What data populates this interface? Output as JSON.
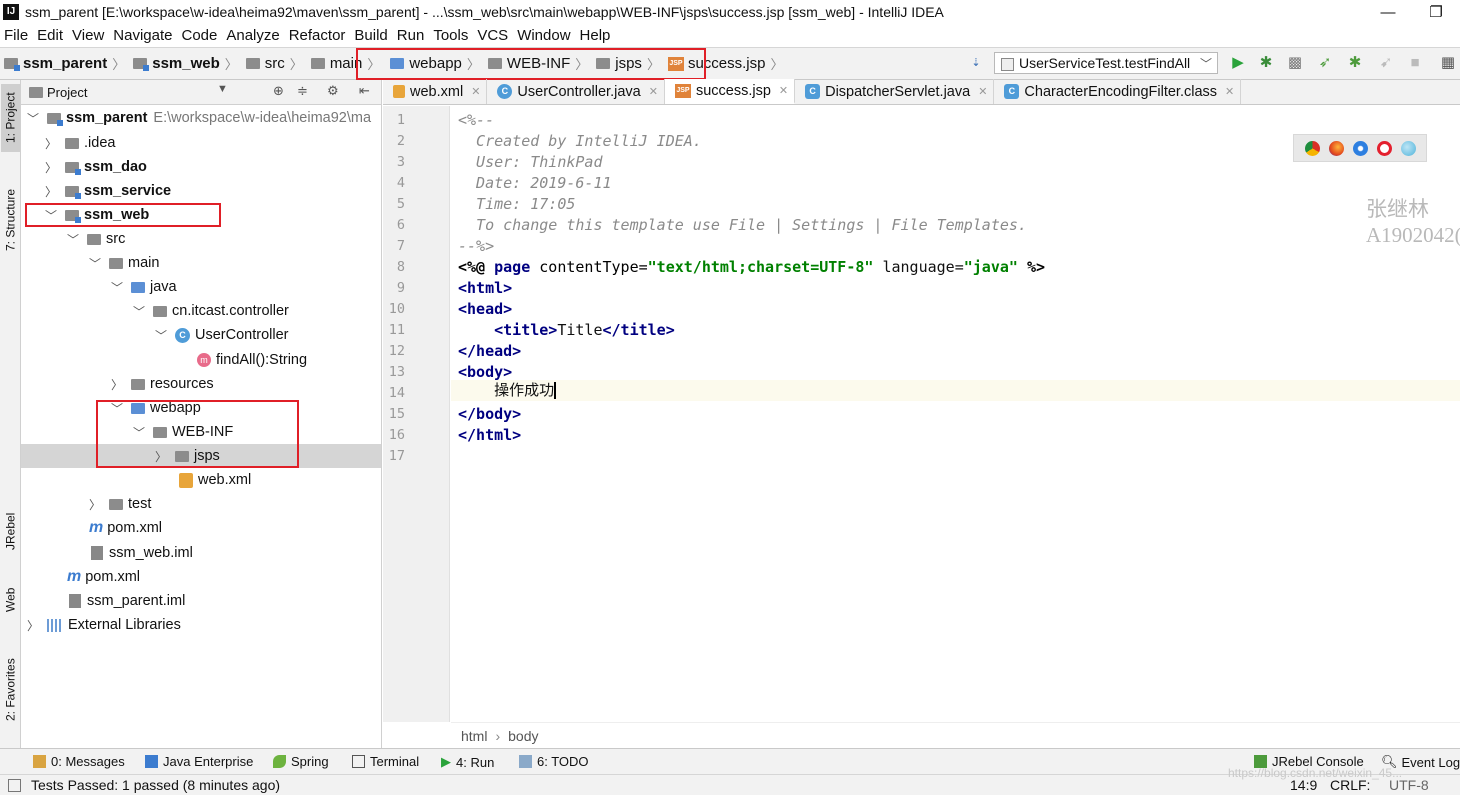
{
  "window": {
    "title": "ssm_parent [E:\\workspace\\w-idea\\heima92\\maven\\ssm_parent] - ...\\ssm_web\\src\\main\\webapp\\WEB-INF\\jsps\\success.jsp [ssm_web] - IntelliJ IDEA",
    "minimize": "—",
    "maximize": "❐"
  },
  "menu": [
    "File",
    "Edit",
    "View",
    "Navigate",
    "Code",
    "Analyze",
    "Refactor",
    "Build",
    "Run",
    "Tools",
    "VCS",
    "Window",
    "Help"
  ],
  "navbar": {
    "crumbs": [
      "ssm_parent",
      "ssm_web",
      "src",
      "main",
      "webapp",
      "WEB-INF",
      "jsps",
      "success.jsp"
    ],
    "run_config": "UserServiceTest.testFindAll"
  },
  "left_tools": [
    "1: Project",
    "7: Structure",
    "JRebel",
    "Web",
    "2: Favorites"
  ],
  "project": {
    "header": "Project",
    "rows": [
      {
        "label": "ssm_parent",
        "path": "E:\\workspace\\w-idea\\heima92\\ma"
      },
      {
        "label": ".idea"
      },
      {
        "label": "ssm_dao"
      },
      {
        "label": "ssm_service"
      },
      {
        "label": "ssm_web"
      },
      {
        "label": "src"
      },
      {
        "label": "main"
      },
      {
        "label": "java"
      },
      {
        "label": "cn.itcast.controller"
      },
      {
        "label": "UserController"
      },
      {
        "label": "findAll():String"
      },
      {
        "label": "resources"
      },
      {
        "label": "webapp"
      },
      {
        "label": "WEB-INF"
      },
      {
        "label": "jsps"
      },
      {
        "label": "web.xml"
      },
      {
        "label": "test"
      },
      {
        "label": "pom.xml"
      },
      {
        "label": "ssm_web.iml"
      },
      {
        "label": "pom.xml"
      },
      {
        "label": "ssm_parent.iml"
      },
      {
        "label": "External Libraries"
      }
    ]
  },
  "tabs": [
    "web.xml",
    "UserController.java",
    "success.jsp",
    "DispatcherServlet.java",
    "CharacterEncodingFilter.class"
  ],
  "editor": {
    "line_numbers": [
      "1",
      "2",
      "3",
      "4",
      "5",
      "6",
      "7",
      "8",
      "9",
      "10",
      "11",
      "12",
      "13",
      "14",
      "15",
      "16",
      "17"
    ],
    "comment_open": "<%--",
    "comment_lines": [
      "  Created by IntelliJ IDEA.",
      "  User: ThinkPad",
      "  Date: 2019-6-11",
      "  Time: 17:05",
      "  To change this template use File | Settings | File Templates."
    ],
    "comment_close": "--%>",
    "directive": {
      "open": "<%@ ",
      "kw": "page",
      "attr1": " contentType=",
      "val1": "\"text/html;charset=UTF-8\"",
      "attr2": " language=",
      "val2": "\"java\"",
      "close": " %>"
    },
    "html_open": "<html>",
    "head_open": "<head>",
    "title_open": "<title>",
    "title_text": "Title",
    "title_close": "</title>",
    "head_close": "</head>",
    "body_open": "<body>",
    "body_text": "操作成功",
    "body_close": "</body>",
    "html_close": "</html>",
    "breadcrumb": [
      "html",
      "body"
    ]
  },
  "watermark": [
    "张继林",
    "A1902042("
  ],
  "bottom_tools": [
    "0: Messages",
    "Java Enterprise",
    "Spring",
    "Terminal",
    "4: Run",
    "6: TODO",
    "JRebel Console",
    "Event Log"
  ],
  "status": {
    "message": "Tests Passed: 1 passed (8 minutes ago)",
    "position": "14:9",
    "line_sep": "CRLF:",
    "encoding": "UTF-8",
    "url": "https://blog.csdn.net/weixin_45..."
  },
  "colors": {
    "highlight_box": "#e01f27",
    "selection": "#d5d5d5",
    "tag": "#000080",
    "string": "#008000",
    "comment": "#8a8a8a"
  }
}
